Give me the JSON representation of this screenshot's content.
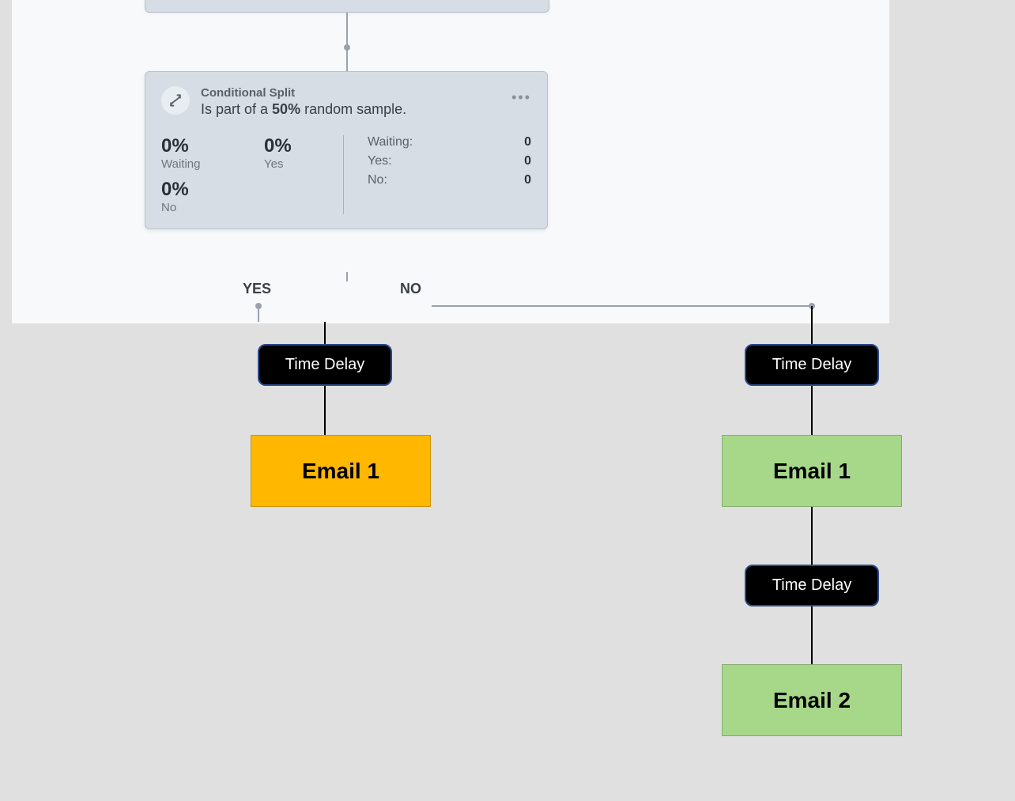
{
  "card": {
    "title": "Conditional Split",
    "description_prefix": "Is part of a ",
    "description_bold": "50%",
    "description_suffix": " random sample.",
    "stats_left": [
      {
        "value": "0%",
        "label": "Waiting"
      },
      {
        "value": "0%",
        "label": "Yes"
      },
      {
        "value": "0%",
        "label": "No"
      }
    ],
    "stats_right": [
      {
        "label": "Waiting:",
        "value": "0"
      },
      {
        "label": "Yes:",
        "value": "0"
      },
      {
        "label": "No:",
        "value": "0"
      }
    ]
  },
  "branches": {
    "yes_label": "YES",
    "no_label": "NO"
  },
  "yes_flow": {
    "delay": "Time Delay",
    "email1": "Email 1"
  },
  "no_flow": {
    "delay1": "Time Delay",
    "email1": "Email 1",
    "delay2": "Time Delay",
    "email2": "Email 2"
  }
}
